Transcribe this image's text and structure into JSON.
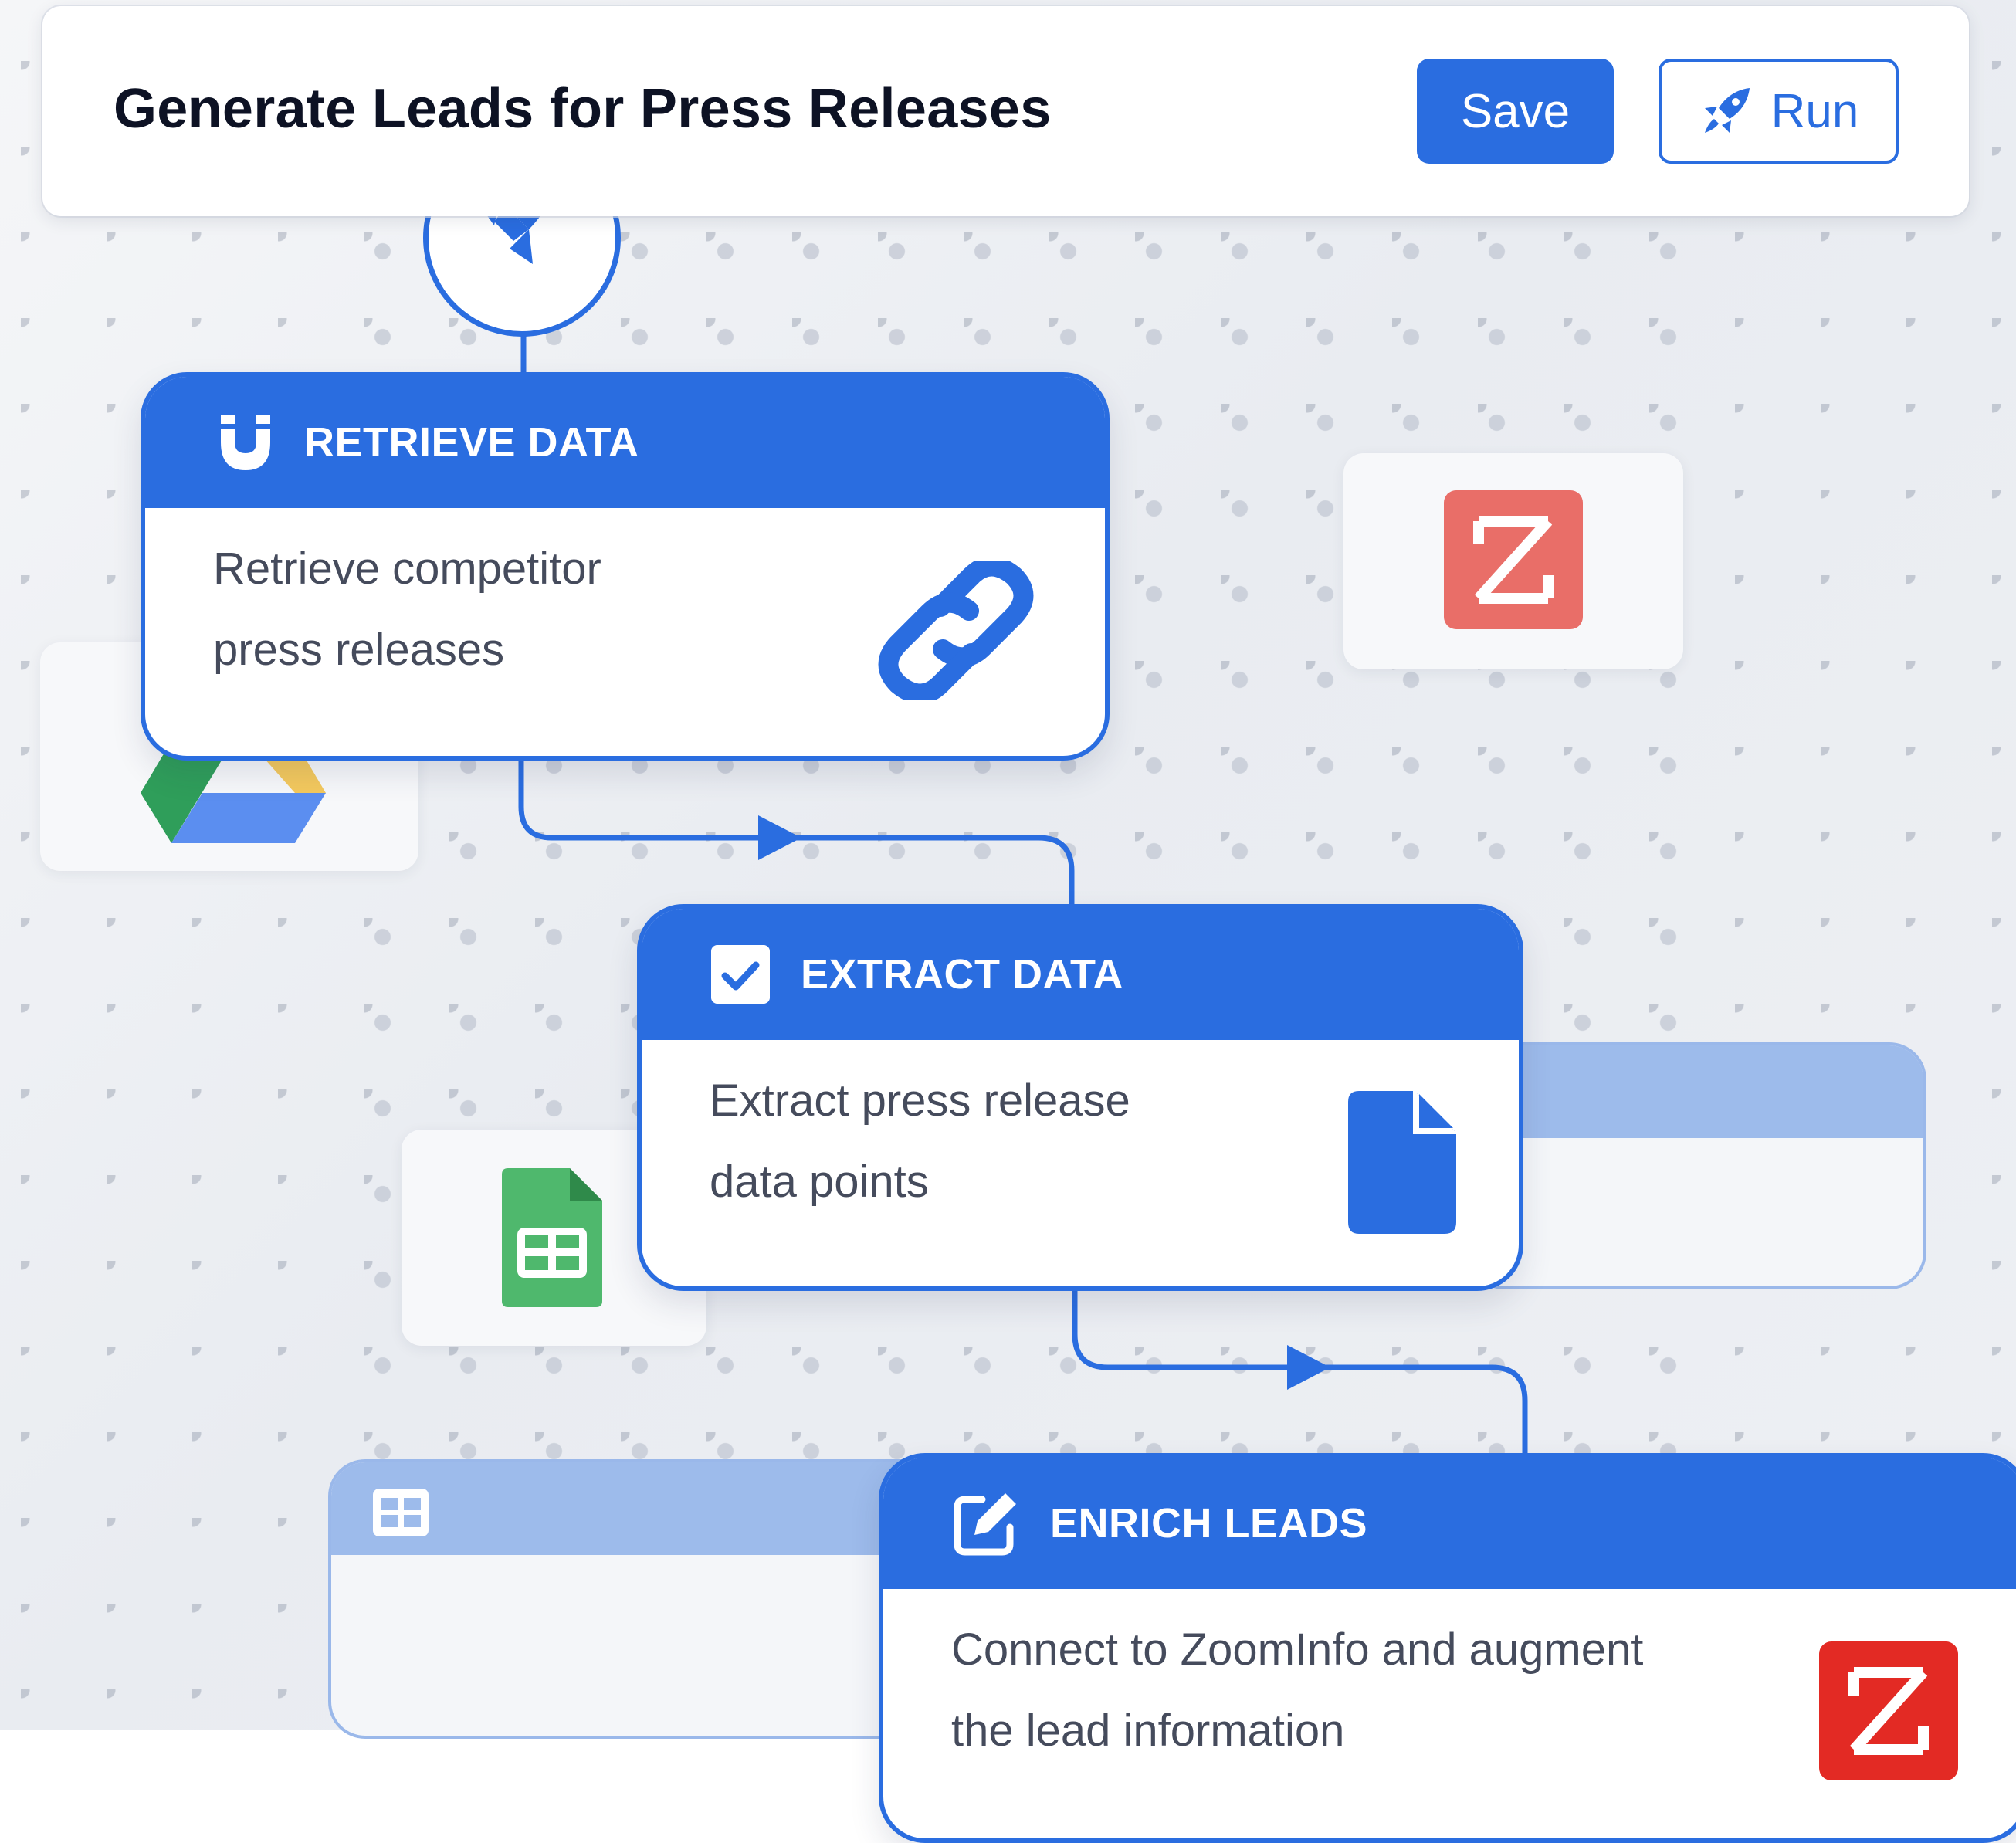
{
  "toolbar": {
    "title": "Generate Leads for Press Releases",
    "save_label": "Save",
    "run_label": "Run",
    "run_icon": "rocket-icon"
  },
  "start_node": {
    "icon": "rocket-icon"
  },
  "steps": [
    {
      "title": "RETRIEVE DATA",
      "header_icon": "magnet-icon",
      "description_line1": "Retrieve competitor",
      "description_line2": "press releases",
      "body_icon": "link-icon"
    },
    {
      "title": "EXTRACT DATA",
      "header_icon": "checkbox-icon",
      "description_line1": "Extract press release",
      "description_line2": "data points",
      "body_icon": "document-icon"
    },
    {
      "title": "ENRICH LEADS",
      "header_icon": "edit-icon",
      "description_line1": "Connect to ZoomInfo and augment",
      "description_line2": "the lead information",
      "body_icon": "zoominfo-logo"
    }
  ],
  "background_tiles": [
    "zoominfo-logo",
    "google-drive-logo",
    "google-sheets-logo",
    "table-icon"
  ],
  "colors": {
    "primary": "#2a6de0",
    "zoominfo_red": "#e32a24",
    "zoominfo_faded": "#e96e68",
    "sheets_green": "#34a853",
    "background": "#eef0f4"
  }
}
